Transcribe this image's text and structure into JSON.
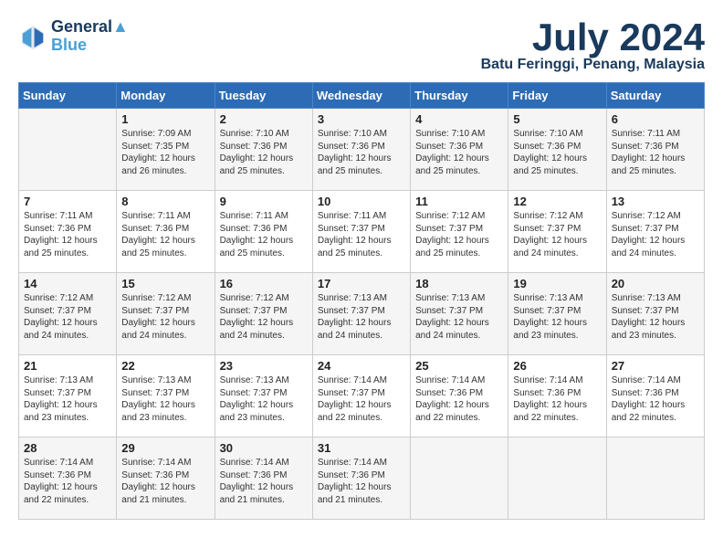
{
  "header": {
    "logo_line1": "General",
    "logo_line2": "Blue",
    "month_title": "July 2024",
    "location": "Batu Feringgi, Penang, Malaysia"
  },
  "days_of_week": [
    "Sunday",
    "Monday",
    "Tuesday",
    "Wednesday",
    "Thursday",
    "Friday",
    "Saturday"
  ],
  "weeks": [
    [
      {
        "day": "",
        "info": ""
      },
      {
        "day": "1",
        "info": "Sunrise: 7:09 AM\nSunset: 7:35 PM\nDaylight: 12 hours\nand 26 minutes."
      },
      {
        "day": "2",
        "info": "Sunrise: 7:10 AM\nSunset: 7:36 PM\nDaylight: 12 hours\nand 25 minutes."
      },
      {
        "day": "3",
        "info": "Sunrise: 7:10 AM\nSunset: 7:36 PM\nDaylight: 12 hours\nand 25 minutes."
      },
      {
        "day": "4",
        "info": "Sunrise: 7:10 AM\nSunset: 7:36 PM\nDaylight: 12 hours\nand 25 minutes."
      },
      {
        "day": "5",
        "info": "Sunrise: 7:10 AM\nSunset: 7:36 PM\nDaylight: 12 hours\nand 25 minutes."
      },
      {
        "day": "6",
        "info": "Sunrise: 7:11 AM\nSunset: 7:36 PM\nDaylight: 12 hours\nand 25 minutes."
      }
    ],
    [
      {
        "day": "7",
        "info": "Sunrise: 7:11 AM\nSunset: 7:36 PM\nDaylight: 12 hours\nand 25 minutes."
      },
      {
        "day": "8",
        "info": "Sunrise: 7:11 AM\nSunset: 7:36 PM\nDaylight: 12 hours\nand 25 minutes."
      },
      {
        "day": "9",
        "info": "Sunrise: 7:11 AM\nSunset: 7:36 PM\nDaylight: 12 hours\nand 25 minutes."
      },
      {
        "day": "10",
        "info": "Sunrise: 7:11 AM\nSunset: 7:37 PM\nDaylight: 12 hours\nand 25 minutes."
      },
      {
        "day": "11",
        "info": "Sunrise: 7:12 AM\nSunset: 7:37 PM\nDaylight: 12 hours\nand 25 minutes."
      },
      {
        "day": "12",
        "info": "Sunrise: 7:12 AM\nSunset: 7:37 PM\nDaylight: 12 hours\nand 24 minutes."
      },
      {
        "day": "13",
        "info": "Sunrise: 7:12 AM\nSunset: 7:37 PM\nDaylight: 12 hours\nand 24 minutes."
      }
    ],
    [
      {
        "day": "14",
        "info": "Sunrise: 7:12 AM\nSunset: 7:37 PM\nDaylight: 12 hours\nand 24 minutes."
      },
      {
        "day": "15",
        "info": "Sunrise: 7:12 AM\nSunset: 7:37 PM\nDaylight: 12 hours\nand 24 minutes."
      },
      {
        "day": "16",
        "info": "Sunrise: 7:12 AM\nSunset: 7:37 PM\nDaylight: 12 hours\nand 24 minutes."
      },
      {
        "day": "17",
        "info": "Sunrise: 7:13 AM\nSunset: 7:37 PM\nDaylight: 12 hours\nand 24 minutes."
      },
      {
        "day": "18",
        "info": "Sunrise: 7:13 AM\nSunset: 7:37 PM\nDaylight: 12 hours\nand 24 minutes."
      },
      {
        "day": "19",
        "info": "Sunrise: 7:13 AM\nSunset: 7:37 PM\nDaylight: 12 hours\nand 23 minutes."
      },
      {
        "day": "20",
        "info": "Sunrise: 7:13 AM\nSunset: 7:37 PM\nDaylight: 12 hours\nand 23 minutes."
      }
    ],
    [
      {
        "day": "21",
        "info": "Sunrise: 7:13 AM\nSunset: 7:37 PM\nDaylight: 12 hours\nand 23 minutes."
      },
      {
        "day": "22",
        "info": "Sunrise: 7:13 AM\nSunset: 7:37 PM\nDaylight: 12 hours\nand 23 minutes."
      },
      {
        "day": "23",
        "info": "Sunrise: 7:13 AM\nSunset: 7:37 PM\nDaylight: 12 hours\nand 23 minutes."
      },
      {
        "day": "24",
        "info": "Sunrise: 7:14 AM\nSunset: 7:37 PM\nDaylight: 12 hours\nand 22 minutes."
      },
      {
        "day": "25",
        "info": "Sunrise: 7:14 AM\nSunset: 7:36 PM\nDaylight: 12 hours\nand 22 minutes."
      },
      {
        "day": "26",
        "info": "Sunrise: 7:14 AM\nSunset: 7:36 PM\nDaylight: 12 hours\nand 22 minutes."
      },
      {
        "day": "27",
        "info": "Sunrise: 7:14 AM\nSunset: 7:36 PM\nDaylight: 12 hours\nand 22 minutes."
      }
    ],
    [
      {
        "day": "28",
        "info": "Sunrise: 7:14 AM\nSunset: 7:36 PM\nDaylight: 12 hours\nand 22 minutes."
      },
      {
        "day": "29",
        "info": "Sunrise: 7:14 AM\nSunset: 7:36 PM\nDaylight: 12 hours\nand 21 minutes."
      },
      {
        "day": "30",
        "info": "Sunrise: 7:14 AM\nSunset: 7:36 PM\nDaylight: 12 hours\nand 21 minutes."
      },
      {
        "day": "31",
        "info": "Sunrise: 7:14 AM\nSunset: 7:36 PM\nDaylight: 12 hours\nand 21 minutes."
      },
      {
        "day": "",
        "info": ""
      },
      {
        "day": "",
        "info": ""
      },
      {
        "day": "",
        "info": ""
      }
    ]
  ]
}
